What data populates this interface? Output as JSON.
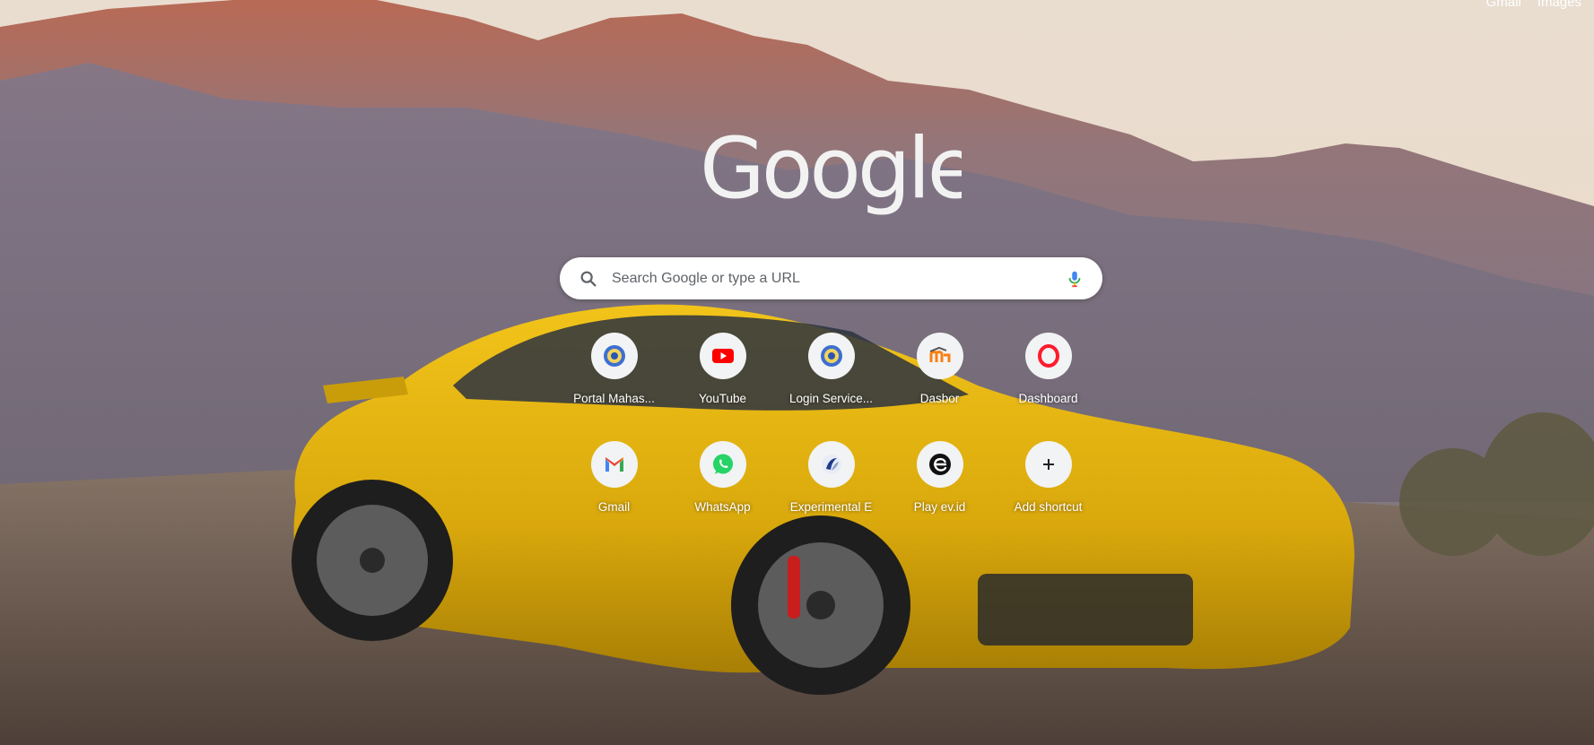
{
  "header": {
    "links": [
      "Gmail",
      "Images"
    ]
  },
  "logo": {
    "text": "Google"
  },
  "search": {
    "placeholder": "Search Google or type a URL"
  },
  "shortcuts": [
    {
      "label": "Portal Mahas...",
      "icon": "university-seal-icon"
    },
    {
      "label": "YouTube",
      "icon": "youtube-icon"
    },
    {
      "label": "Login Service...",
      "icon": "university-seal-icon"
    },
    {
      "label": "Dasbor",
      "icon": "moodle-icon"
    },
    {
      "label": "Dashboard",
      "icon": "opera-icon"
    },
    {
      "label": "Gmail",
      "icon": "gmail-icon"
    },
    {
      "label": "WhatsApp",
      "icon": "whatsapp-icon"
    },
    {
      "label": "Experimental E",
      "icon": "experimental-icon"
    },
    {
      "label": "Play ev.id",
      "icon": "ev-icon"
    },
    {
      "label": "Add shortcut",
      "icon": "plus-icon"
    }
  ],
  "colors": {
    "youtube": "#ff0000",
    "whatsapp": "#25d366",
    "opera": "#ff1b2d",
    "moodle": "#f98012",
    "seal": "#4a7bd6",
    "car": "#e2b20f"
  }
}
